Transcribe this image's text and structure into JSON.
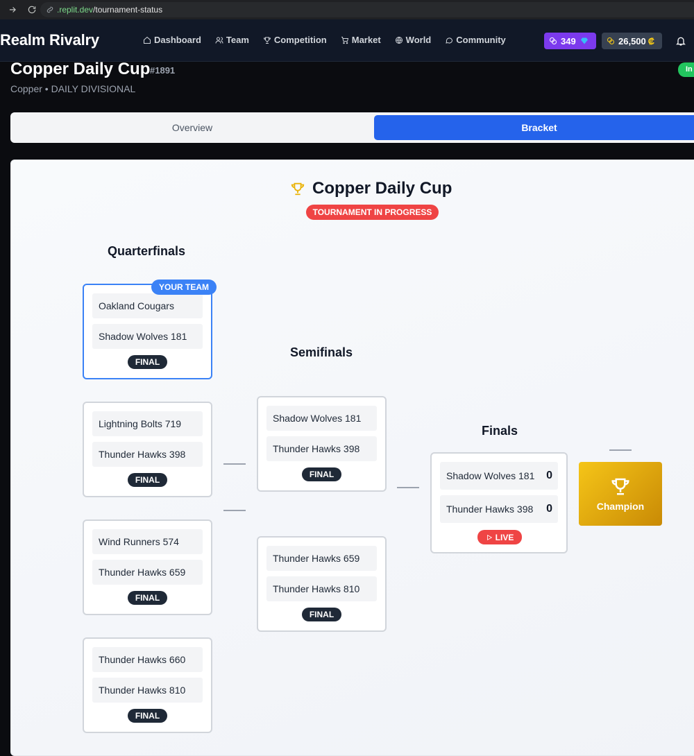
{
  "browser": {
    "url_host_prefix": ".replit.dev",
    "url_path": "/tournament-status"
  },
  "header": {
    "brand": "Realm Rivalry",
    "nav": [
      {
        "label": "Dashboard",
        "icon": "home-icon"
      },
      {
        "label": "Team",
        "icon": "users-icon"
      },
      {
        "label": "Competition",
        "icon": "trophy-icon"
      },
      {
        "label": "Market",
        "icon": "cart-icon"
      },
      {
        "label": "World",
        "icon": "globe-icon"
      },
      {
        "label": "Community",
        "icon": "chat-icon"
      }
    ],
    "gems": "349",
    "credits": "26,500",
    "credit_symbol": "₡"
  },
  "page": {
    "title": "Copper Daily Cup",
    "id": "#1891",
    "subtitle": "Copper • DAILY DIVISIONAL",
    "status": "In"
  },
  "tabs": {
    "overview": "Overview",
    "bracket": "Bracket"
  },
  "bracket": {
    "title": "Copper Daily Cup",
    "status": "TOURNAMENT IN PROGRESS",
    "your_team_label": "YOUR TEAM",
    "rounds": {
      "qf": "Quarterfinals",
      "sf": "Semifinals",
      "final": "Finals"
    },
    "quarterfinals": [
      {
        "team1": "Oakland Cougars",
        "team2": "Shadow Wolves 181",
        "status": "FINAL"
      },
      {
        "team1": "Lightning Bolts 719",
        "team2": "Thunder Hawks 398",
        "status": "FINAL"
      },
      {
        "team1": "Wind Runners 574",
        "team2": "Thunder Hawks 659",
        "status": "FINAL"
      },
      {
        "team1": "Thunder Hawks 660",
        "team2": "Thunder Hawks 810",
        "status": "FINAL"
      }
    ],
    "semifinals": [
      {
        "team1": "Shadow Wolves 181",
        "team2": "Thunder Hawks 398",
        "status": "FINAL"
      },
      {
        "team1": "Thunder Hawks 659",
        "team2": "Thunder Hawks 810",
        "status": "FINAL"
      }
    ],
    "final": {
      "team1": "Shadow Wolves 181",
      "score1": "0",
      "team2": "Thunder Hawks 398",
      "score2": "0",
      "status": "LIVE"
    },
    "champion_label": "Champion"
  },
  "colors": {
    "accent": "#2563eb",
    "live": "#ef4444",
    "gem": "#7c3aed",
    "gold": "#f5c518"
  }
}
